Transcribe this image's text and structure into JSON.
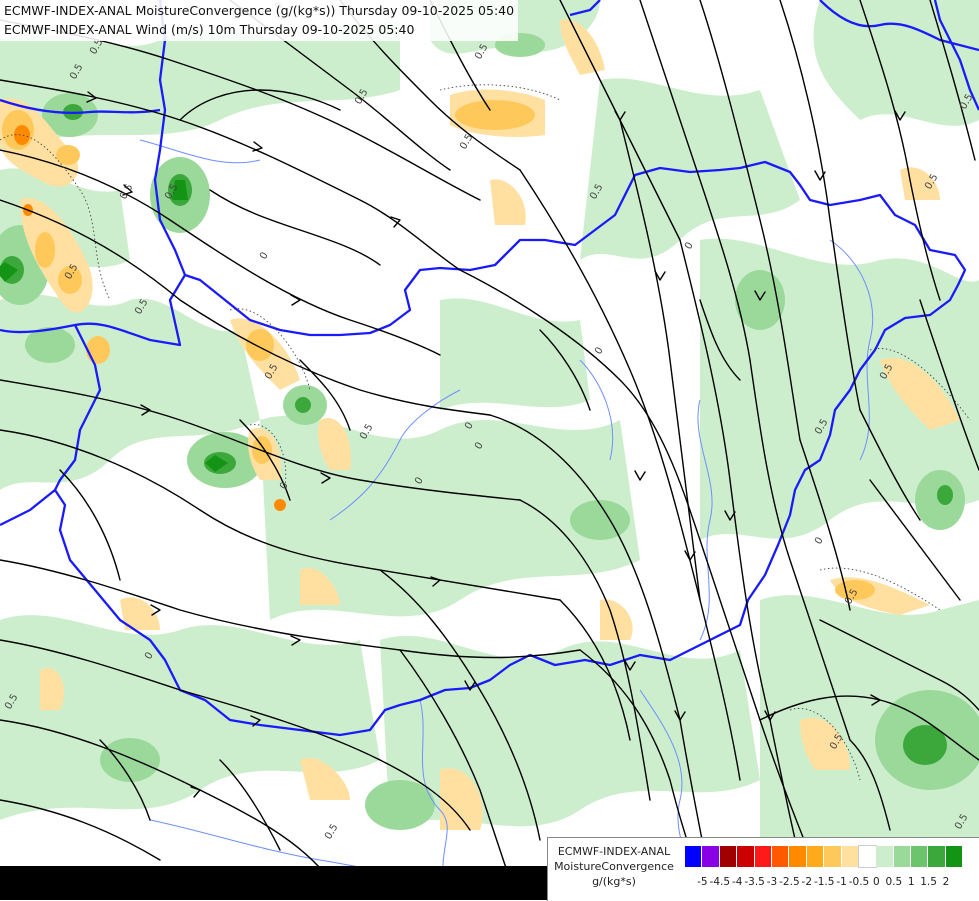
{
  "titles": {
    "line1": "ECMWF-INDEX-ANAL MoistureConvergence (g/(kg*s)) Thursday 09-10-2025 05:40",
    "line2": "ECMWF-INDEX-ANAL Wind (m/s) 10m Thursday 09-10-2025 05:40"
  },
  "legend": {
    "title_line1": "ECMWF-INDEX-ANAL",
    "title_line2": "MoistureConvergence",
    "unit": "g/(kg*s)",
    "colors": [
      "#0000ff",
      "#8a00e6",
      "#a00000",
      "#cc0000",
      "#ff1a1a",
      "#ff5a00",
      "#ff8a00",
      "#ffaa1a",
      "#ffc85a",
      "#ffe0a0",
      "#ffffff",
      "#cdeecd",
      "#9bd99b",
      "#6cc46c",
      "#3ca83c",
      "#149414"
    ],
    "tick_labels": [
      "-5",
      "-4.5",
      "-4",
      "-3.5",
      "-3",
      "-2.5",
      "-2",
      "-1.5",
      "-1",
      "-0.5",
      "0",
      "0.5",
      "1",
      "1.5",
      "2"
    ]
  },
  "contour_labels": [
    "0.5",
    "0.5",
    "0.5",
    "0.5",
    "0.5",
    "0.5",
    "0.5",
    "0.5",
    "0.5",
    "0.5",
    "0.5",
    "0",
    "0",
    "0",
    "0",
    "0",
    "0",
    "0.5",
    "0.5",
    "0.5",
    "0",
    "0",
    "0",
    "0.5",
    "0.5",
    "0.5",
    "0.5",
    "0.5",
    "0.5",
    "0",
    "0.5"
  ],
  "colors": {
    "border": "#1a1aff",
    "river": "#6f8fff",
    "streamline": "#000000",
    "contour": "#444444"
  }
}
